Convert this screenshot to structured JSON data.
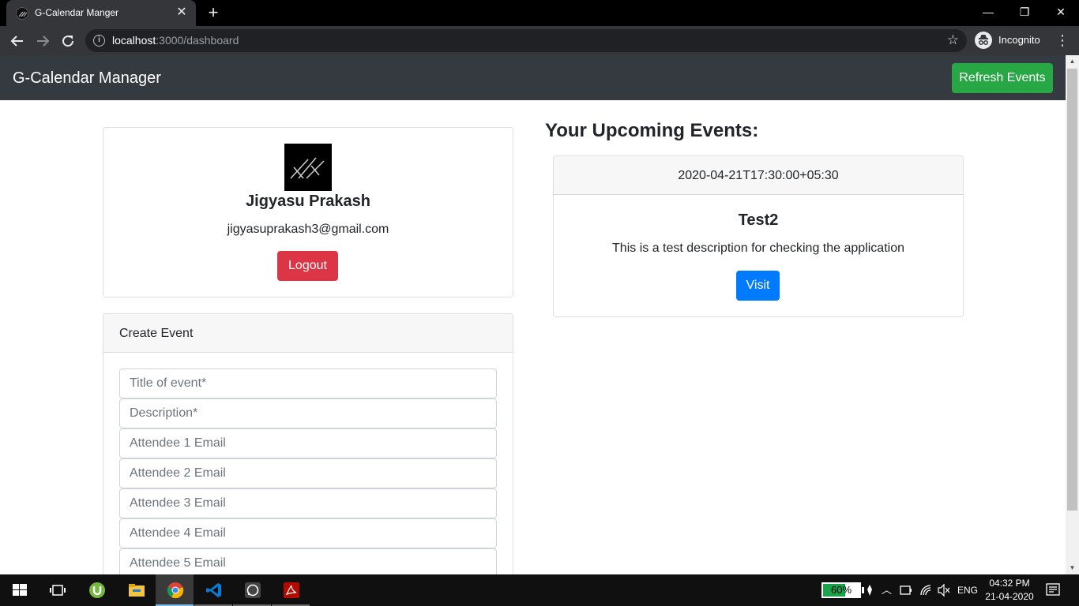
{
  "browser": {
    "tab_title": "G-Calendar Manger",
    "url_host": "localhost",
    "url_rest": ":3000/dashboard",
    "profile_label": "Incognito"
  },
  "app": {
    "brand": "G-Calendar Manager",
    "refresh_label": "Refresh Events"
  },
  "profile": {
    "name": "Jigyasu Prakash",
    "email": "jigyasuprakash3@gmail.com",
    "logout_label": "Logout"
  },
  "create_event": {
    "header": "Create Event",
    "fields": [
      {
        "placeholder": "Title of event*"
      },
      {
        "placeholder": "Description*"
      },
      {
        "placeholder": "Attendee 1 Email"
      },
      {
        "placeholder": "Attendee 2 Email"
      },
      {
        "placeholder": "Attendee 3 Email"
      },
      {
        "placeholder": "Attendee 4 Email"
      },
      {
        "placeholder": "Attendee 5 Email"
      }
    ]
  },
  "events": {
    "heading": "Your Upcoming Events:",
    "items": [
      {
        "start": "2020-04-21T17:30:00+05:30",
        "title": "Test2",
        "description": "This is a test description for checking the application",
        "visit_label": "Visit"
      }
    ]
  },
  "taskbar": {
    "battery_percent": "60%",
    "battery_level": 0.6,
    "language": "ENG",
    "time": "04:32 PM",
    "date": "21-04-2020",
    "apps": [
      "start-icon",
      "task-view-icon",
      "utorrent-icon",
      "file-explorer-icon",
      "chrome-icon",
      "vscode-icon",
      "whatsapp-icon",
      "acrobat-icon"
    ]
  },
  "colors": {
    "navbar": "#343a40",
    "success": "#28a745",
    "danger": "#dc3545",
    "primary": "#007bff"
  }
}
